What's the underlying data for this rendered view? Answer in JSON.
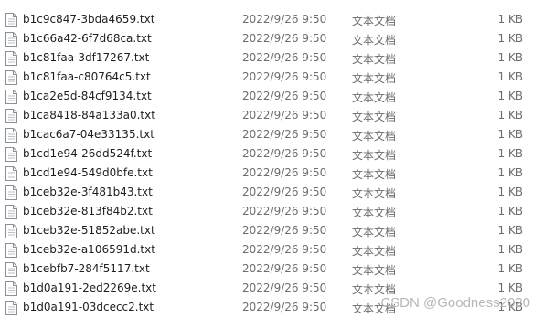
{
  "colors": {
    "name_text": "#1e1e1e",
    "meta_text": "#6d6d6d",
    "icon_stroke": "#8a8f96",
    "icon_fill": "#ffffff",
    "icon_lines": "#b9bec6"
  },
  "icons": {
    "file": "text-file-icon"
  },
  "files": [
    {
      "name": "b1c9c847-3bda4659.txt",
      "date": "2022/9/26 9:50",
      "type": "文本文档",
      "size": "1 KB"
    },
    {
      "name": "b1c66a42-6f7d68ca.txt",
      "date": "2022/9/26 9:50",
      "type": "文本文档",
      "size": "1 KB"
    },
    {
      "name": "b1c81faa-3df17267.txt",
      "date": "2022/9/26 9:50",
      "type": "文本文档",
      "size": "1 KB"
    },
    {
      "name": "b1c81faa-c80764c5.txt",
      "date": "2022/9/26 9:50",
      "type": "文本文档",
      "size": "1 KB"
    },
    {
      "name": "b1ca2e5d-84cf9134.txt",
      "date": "2022/9/26 9:50",
      "type": "文本文档",
      "size": "1 KB"
    },
    {
      "name": "b1ca8418-84a133a0.txt",
      "date": "2022/9/26 9:50",
      "type": "文本文档",
      "size": "1 KB"
    },
    {
      "name": "b1cac6a7-04e33135.txt",
      "date": "2022/9/26 9:50",
      "type": "文本文档",
      "size": "1 KB"
    },
    {
      "name": "b1cd1e94-26dd524f.txt",
      "date": "2022/9/26 9:50",
      "type": "文本文档",
      "size": "1 KB"
    },
    {
      "name": "b1cd1e94-549d0bfe.txt",
      "date": "2022/9/26 9:50",
      "type": "文本文档",
      "size": "1 KB"
    },
    {
      "name": "b1ceb32e-3f481b43.txt",
      "date": "2022/9/26 9:50",
      "type": "文本文档",
      "size": "1 KB"
    },
    {
      "name": "b1ceb32e-813f84b2.txt",
      "date": "2022/9/26 9:50",
      "type": "文本文档",
      "size": "1 KB"
    },
    {
      "name": "b1ceb32e-51852abe.txt",
      "date": "2022/9/26 9:50",
      "type": "文本文档",
      "size": "1 KB"
    },
    {
      "name": "b1ceb32e-a106591d.txt",
      "date": "2022/9/26 9:50",
      "type": "文本文档",
      "size": "1 KB"
    },
    {
      "name": "b1cebfb7-284f5117.txt",
      "date": "2022/9/26 9:50",
      "type": "文本文档",
      "size": "1 KB"
    },
    {
      "name": "b1d0a191-2ed2269e.txt",
      "date": "2022/9/26 9:50",
      "type": "文本文档",
      "size": "1 KB"
    },
    {
      "name": "b1d0a191-03dcecc2.txt",
      "date": "2022/9/26 9:50",
      "type": "文本文档",
      "size": "1 KB"
    }
  ],
  "watermark": "CSDN @Goodness2020"
}
